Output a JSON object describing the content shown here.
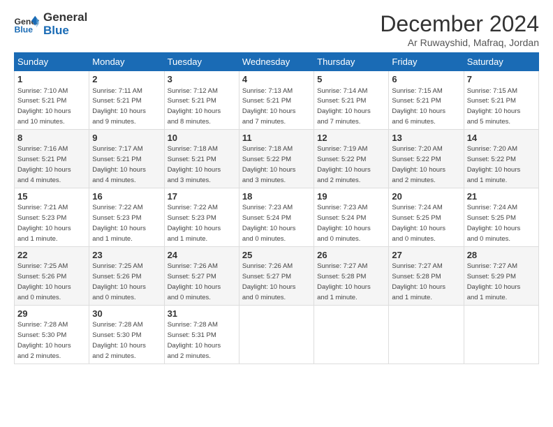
{
  "header": {
    "logo_line1": "General",
    "logo_line2": "Blue",
    "month": "December 2024",
    "location": "Ar Ruwayshid, Mafraq, Jordan"
  },
  "days_of_week": [
    "Sunday",
    "Monday",
    "Tuesday",
    "Wednesday",
    "Thursday",
    "Friday",
    "Saturday"
  ],
  "weeks": [
    [
      {
        "day": "1",
        "info": "Sunrise: 7:10 AM\nSunset: 5:21 PM\nDaylight: 10 hours\nand 10 minutes."
      },
      {
        "day": "2",
        "info": "Sunrise: 7:11 AM\nSunset: 5:21 PM\nDaylight: 10 hours\nand 9 minutes."
      },
      {
        "day": "3",
        "info": "Sunrise: 7:12 AM\nSunset: 5:21 PM\nDaylight: 10 hours\nand 8 minutes."
      },
      {
        "day": "4",
        "info": "Sunrise: 7:13 AM\nSunset: 5:21 PM\nDaylight: 10 hours\nand 7 minutes."
      },
      {
        "day": "5",
        "info": "Sunrise: 7:14 AM\nSunset: 5:21 PM\nDaylight: 10 hours\nand 7 minutes."
      },
      {
        "day": "6",
        "info": "Sunrise: 7:15 AM\nSunset: 5:21 PM\nDaylight: 10 hours\nand 6 minutes."
      },
      {
        "day": "7",
        "info": "Sunrise: 7:15 AM\nSunset: 5:21 PM\nDaylight: 10 hours\nand 5 minutes."
      }
    ],
    [
      {
        "day": "8",
        "info": "Sunrise: 7:16 AM\nSunset: 5:21 PM\nDaylight: 10 hours\nand 4 minutes."
      },
      {
        "day": "9",
        "info": "Sunrise: 7:17 AM\nSunset: 5:21 PM\nDaylight: 10 hours\nand 4 minutes."
      },
      {
        "day": "10",
        "info": "Sunrise: 7:18 AM\nSunset: 5:21 PM\nDaylight: 10 hours\nand 3 minutes."
      },
      {
        "day": "11",
        "info": "Sunrise: 7:18 AM\nSunset: 5:22 PM\nDaylight: 10 hours\nand 3 minutes."
      },
      {
        "day": "12",
        "info": "Sunrise: 7:19 AM\nSunset: 5:22 PM\nDaylight: 10 hours\nand 2 minutes."
      },
      {
        "day": "13",
        "info": "Sunrise: 7:20 AM\nSunset: 5:22 PM\nDaylight: 10 hours\nand 2 minutes."
      },
      {
        "day": "14",
        "info": "Sunrise: 7:20 AM\nSunset: 5:22 PM\nDaylight: 10 hours\nand 1 minute."
      }
    ],
    [
      {
        "day": "15",
        "info": "Sunrise: 7:21 AM\nSunset: 5:23 PM\nDaylight: 10 hours\nand 1 minute."
      },
      {
        "day": "16",
        "info": "Sunrise: 7:22 AM\nSunset: 5:23 PM\nDaylight: 10 hours\nand 1 minute."
      },
      {
        "day": "17",
        "info": "Sunrise: 7:22 AM\nSunset: 5:23 PM\nDaylight: 10 hours\nand 1 minute."
      },
      {
        "day": "18",
        "info": "Sunrise: 7:23 AM\nSunset: 5:24 PM\nDaylight: 10 hours\nand 0 minutes."
      },
      {
        "day": "19",
        "info": "Sunrise: 7:23 AM\nSunset: 5:24 PM\nDaylight: 10 hours\nand 0 minutes."
      },
      {
        "day": "20",
        "info": "Sunrise: 7:24 AM\nSunset: 5:25 PM\nDaylight: 10 hours\nand 0 minutes."
      },
      {
        "day": "21",
        "info": "Sunrise: 7:24 AM\nSunset: 5:25 PM\nDaylight: 10 hours\nand 0 minutes."
      }
    ],
    [
      {
        "day": "22",
        "info": "Sunrise: 7:25 AM\nSunset: 5:26 PM\nDaylight: 10 hours\nand 0 minutes."
      },
      {
        "day": "23",
        "info": "Sunrise: 7:25 AM\nSunset: 5:26 PM\nDaylight: 10 hours\nand 0 minutes."
      },
      {
        "day": "24",
        "info": "Sunrise: 7:26 AM\nSunset: 5:27 PM\nDaylight: 10 hours\nand 0 minutes."
      },
      {
        "day": "25",
        "info": "Sunrise: 7:26 AM\nSunset: 5:27 PM\nDaylight: 10 hours\nand 0 minutes."
      },
      {
        "day": "26",
        "info": "Sunrise: 7:27 AM\nSunset: 5:28 PM\nDaylight: 10 hours\nand 1 minute."
      },
      {
        "day": "27",
        "info": "Sunrise: 7:27 AM\nSunset: 5:28 PM\nDaylight: 10 hours\nand 1 minute."
      },
      {
        "day": "28",
        "info": "Sunrise: 7:27 AM\nSunset: 5:29 PM\nDaylight: 10 hours\nand 1 minute."
      }
    ],
    [
      {
        "day": "29",
        "info": "Sunrise: 7:28 AM\nSunset: 5:30 PM\nDaylight: 10 hours\nand 2 minutes."
      },
      {
        "day": "30",
        "info": "Sunrise: 7:28 AM\nSunset: 5:30 PM\nDaylight: 10 hours\nand 2 minutes."
      },
      {
        "day": "31",
        "info": "Sunrise: 7:28 AM\nSunset: 5:31 PM\nDaylight: 10 hours\nand 2 minutes."
      },
      {
        "day": "",
        "info": ""
      },
      {
        "day": "",
        "info": ""
      },
      {
        "day": "",
        "info": ""
      },
      {
        "day": "",
        "info": ""
      }
    ]
  ]
}
